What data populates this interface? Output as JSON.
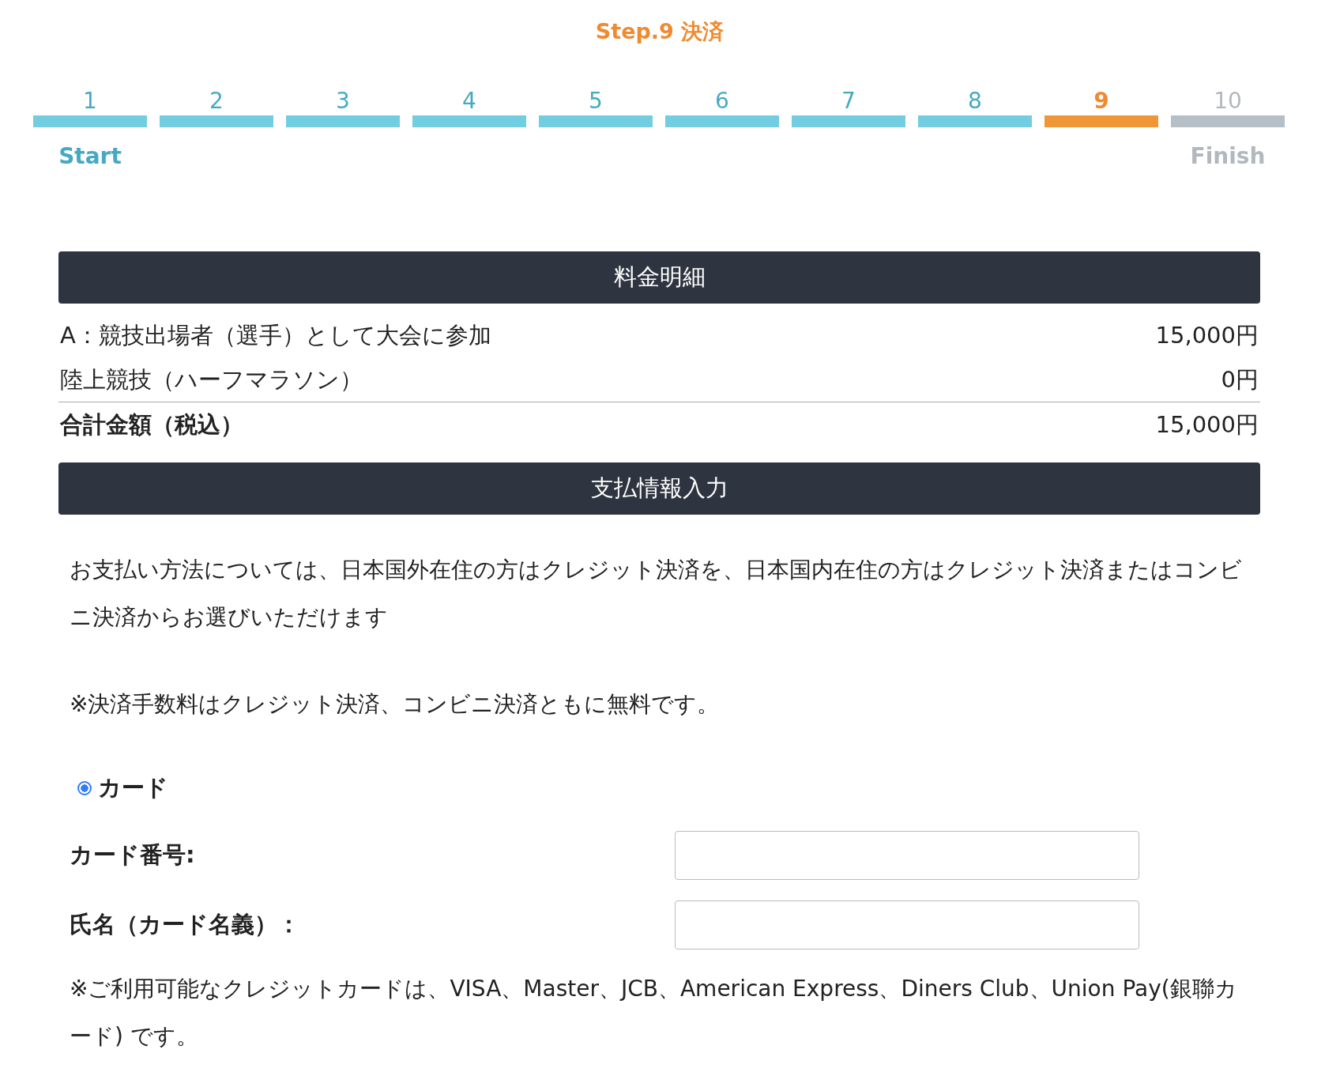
{
  "step_title": "Step.9 決済",
  "steps": [
    {
      "number": "1",
      "completed": true,
      "selected": false,
      "caption": "Start"
    },
    {
      "number": "2",
      "completed": true,
      "selected": false
    },
    {
      "number": "3",
      "completed": true,
      "selected": false
    },
    {
      "number": "4",
      "completed": true,
      "selected": false
    },
    {
      "number": "5",
      "completed": true,
      "selected": false
    },
    {
      "number": "6",
      "completed": true,
      "selected": false
    },
    {
      "number": "7",
      "completed": true,
      "selected": false
    },
    {
      "number": "8",
      "completed": true,
      "selected": false
    },
    {
      "number": "9",
      "completed": false,
      "selected": true
    },
    {
      "number": "10",
      "completed": false,
      "selected": false,
      "caption": "Finish"
    }
  ],
  "fee_section": {
    "title": "料金明細",
    "rows": [
      {
        "label": "A：競技出場者（選手）として大会に参加",
        "amount": "15,000円"
      },
      {
        "label": "陸上競技（ハーフマラソン）",
        "amount": "0円"
      }
    ],
    "total": {
      "label": "合計金額（税込）",
      "amount": "15,000円"
    }
  },
  "payment_section": {
    "title": "支払情報入力",
    "notes": [
      "お支払い方法については、日本国外在住の方はクレジット決済を、日本国内在住の方はクレジット決済またはコンビニ決済からお選びいただけます",
      "※決済手数料はクレジット決済、コンビニ決済ともに無料です。"
    ],
    "methods": [
      {
        "label": "カード",
        "selected": true
      }
    ],
    "fields": [
      {
        "label": "カード番号:"
      },
      {
        "label": "氏名（カード名義）："
      }
    ],
    "card_note": "※ご利用可能なクレジットカードは、VISA、Master、JCB、American Express、Diners Club、Union Pay(銀聯カード) です。"
  }
}
